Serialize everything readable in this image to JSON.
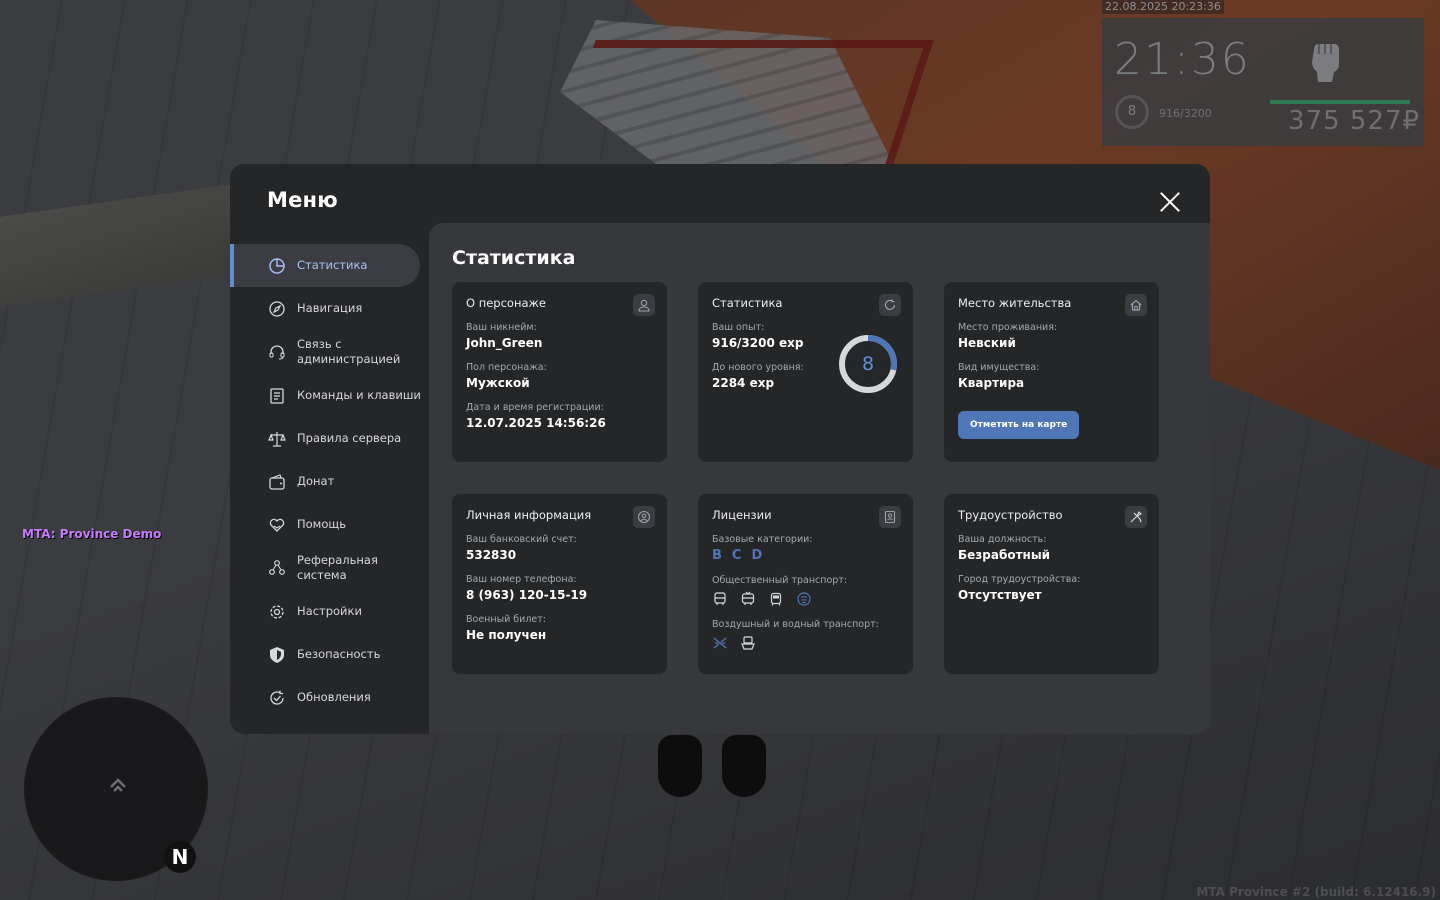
{
  "hud": {
    "datetime": "22.08.2025 20:23:36",
    "time": "21:36",
    "level": "8",
    "exp": "916/3200",
    "money": "375 527₽",
    "fist_icon": "fist-icon",
    "health_color": "#2f7a52"
  },
  "server_tag": "MTA: Province Demo",
  "build_tag": "MTA Province #2 (build: 6.12416.9)",
  "radar": {
    "north": "N"
  },
  "menu": {
    "title": "Меню",
    "accent": "#5f8ed4",
    "sidebar": [
      {
        "label": "Статистика",
        "icon": "pie-chart-icon",
        "active": true
      },
      {
        "label": "Навигация",
        "icon": "compass-icon"
      },
      {
        "label": "Связь с администрацией",
        "icon": "headset-icon"
      },
      {
        "label": "Команды и клавиши",
        "icon": "document-list-icon"
      },
      {
        "label": "Правила сервера",
        "icon": "scales-icon"
      },
      {
        "label": "Донат",
        "icon": "wallet-icon"
      },
      {
        "label": "Помощь",
        "icon": "heart-hands-icon"
      },
      {
        "label": "Реферальная система",
        "icon": "referral-users-icon"
      },
      {
        "label": "Настройки",
        "icon": "gear-icon"
      },
      {
        "label": "Безопасность",
        "icon": "shield-icon"
      },
      {
        "label": "Обновления",
        "icon": "refresh-check-icon"
      }
    ]
  },
  "content": {
    "title": "Статистика",
    "character": {
      "title": "О персонаже",
      "icon": "user-icon",
      "nickname_label": "Ваш никнейм:",
      "nickname": "John_Green",
      "gender_label": "Пол персонажа:",
      "gender": "Мужской",
      "reg_label": "Дата и время регистрации:",
      "reg": "12.07.2025 14:56:26"
    },
    "stats": {
      "title": "Статистика",
      "icon": "refresh-icon",
      "exp_label": "Ваш опыт:",
      "exp": "916/3200 exp",
      "next_label": "До нового уровня:",
      "next": "2284 exp",
      "level": "8",
      "progress": 0.286
    },
    "residence": {
      "title": "Место жительства",
      "icon": "house-icon",
      "place_label": "Место проживания:",
      "place": "Невский",
      "type_label": "Вид имущества:",
      "type": "Квартира",
      "button": "Отметить на карте"
    },
    "personal": {
      "title": "Личная информация",
      "icon": "user-circle-icon",
      "bank_label": "Ваш банковский счет:",
      "bank": "532830",
      "phone_label": "Ваш номер телефона:",
      "phone": "8 (963) 120-15-19",
      "military_label": "Военный билет:",
      "military": "Не получен"
    },
    "licenses": {
      "title": "Лицензии",
      "icon": "id-card-icon",
      "base_label": "Базовые категории:",
      "categories": [
        "B",
        "C",
        "D"
      ],
      "public_label": "Общественный транспорт:",
      "public_icons": [
        "bus-icon",
        "trolleybus-icon",
        "tram-icon",
        "metro-icon"
      ],
      "air_label": "Воздушный и водный транспорт:",
      "air_icons": [
        "plane-icon",
        "boat-icon"
      ]
    },
    "employment": {
      "title": "Трудоустройство",
      "icon": "tools-icon",
      "position_label": "Ваша должность:",
      "position": "Безработный",
      "city_label": "Город трудоустройства:",
      "city": "Отсутствует"
    }
  }
}
